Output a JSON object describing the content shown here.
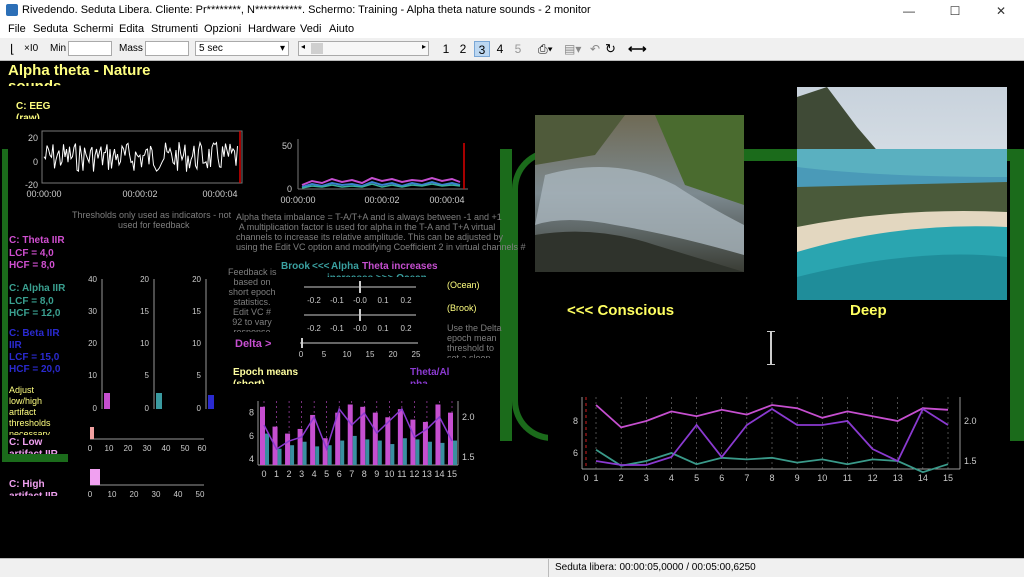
{
  "window": {
    "title": "Rivedendo. Seduta Libera. Cliente: Pr********, N***********. Schermo: Training - Alpha theta nature sounds - 2 monitor",
    "minimize": "—",
    "maximize": "☐",
    "close": "✕"
  },
  "menu": [
    "File",
    "Seduta",
    "Schermi",
    "Edita",
    "Strumenti",
    "Opzioni",
    "Hardware",
    "Vedi",
    "Aiuto"
  ],
  "toolbar": {
    "x0": "×I0",
    "min_label": "Min",
    "max_label": "Mass",
    "time_select": "5 sec",
    "pages": [
      "1",
      "2",
      "3",
      "4",
      "5"
    ],
    "active_page": "3"
  },
  "status": {
    "text": "Seduta libera: 00:00:05,0000 / 00:05:00,6250"
  },
  "screen": {
    "title": "Alpha theta - Nature",
    "title2": "sounds",
    "eeg_label": "C: EEG",
    "eeg_label2": "(raw)",
    "eeg_ticks": [
      "20",
      "0",
      "-20"
    ],
    "time_ticks": [
      "00:00:00",
      "00:00:02",
      "00:00:04"
    ],
    "fft_tick": "50",
    "fft_zero": "0",
    "thresholds_note": "Thresholds only used as indicators - not",
    "thresholds_note2": "used for feedback",
    "imbalance_note": [
      "Alpha theta imbalance = T-A/T+A and is always between -1 and +1",
      "A multiplication factor is used for alpha in the T-A and T+A virtual",
      "channels to increase its relative amplitude.  This can be adjusted by",
      "using the Edit VC option and modifying Coefficient 2 in virtual channels #"
    ],
    "theta_iir": "C: Theta IIR",
    "theta_lcf": "LCF = 4,0",
    "theta_hcf": "HCF = 8,0",
    "alpha_iir": "C: Alpha IIR",
    "alpha_lcf": "LCF = 8,0",
    "alpha_hcf": "HCF = 12,0",
    "beta_iir": "C: Beta IIR",
    "beta_iir2": "IIR",
    "beta_lcf": "LCF = 15,0",
    "beta_hcf": "HCF = 20,0",
    "adjust_note": [
      "Adjust",
      "low/high",
      "artifact",
      "thresholds",
      "necessary"
    ],
    "low_label": "C: Low",
    "low_label2": "artifact IIR",
    "high_label": "C: High",
    "high_label2": "artifact IIR",
    "bar_ticks": [
      "40",
      "30",
      "20",
      "10",
      "0"
    ],
    "bar_ticks2": [
      "20",
      "15",
      "10",
      "5",
      "0"
    ],
    "hbar_ticks": [
      "0",
      "10",
      "20",
      "30",
      "40",
      "50",
      "60"
    ],
    "hbar_ticks2": [
      "0",
      "10",
      "20",
      "30",
      "40",
      "50"
    ],
    "feedback_note": [
      "Feedback is",
      "based on",
      "short epoch",
      "statistics.",
      "Edit VC #",
      "92 to vary",
      "response"
    ],
    "brook": "Brook",
    "arrows_left": "<<<",
    "alpha_word": "Alpha",
    "theta_increases": "Theta increases",
    "increases_line": "increases  >>>  Ocean",
    "scale_ticks": [
      "-0.2",
      "-0.1",
      "-0.0",
      "0.1",
      "0.2"
    ],
    "scale_ticks_b": [
      "0",
      "5",
      "10",
      "15",
      "20",
      "25"
    ],
    "delta": "Delta >",
    "ocean": "(Ocean)",
    "brook_paren": "(Brook)",
    "delta_note": [
      "Use the Delta",
      "epoch mean",
      "threshold to",
      "set a sleep"
    ],
    "epoch_means": "Epoch means",
    "epoch_means2": "(short)",
    "theta_al": "Theta/Al",
    "theta_al2": "pha",
    "conscious": "<<<  Conscious",
    "deep": "Deep"
  },
  "chart_data": [
    {
      "type": "bar",
      "title": "Epoch means (short)",
      "x": [
        0,
        1,
        2,
        3,
        4,
        5,
        6,
        7,
        8,
        9,
        10,
        11,
        12,
        13,
        14,
        15
      ],
      "ylim": [
        3.5,
        9
      ],
      "y2lim": [
        1.4,
        2.2
      ],
      "series": [
        {
          "name": "Theta",
          "color": "#c64fd0",
          "values": [
            8.5,
            6.8,
            6.2,
            6.6,
            7.8,
            5.8,
            8.0,
            8.7,
            8.5,
            8.0,
            7.6,
            8.3,
            7.4,
            7.2,
            8.7,
            8.0
          ]
        },
        {
          "name": "Alpha",
          "color": "#3a8fa0",
          "values": [
            6.2,
            4.9,
            5.2,
            5.5,
            5.1,
            5.2,
            5.6,
            6.0,
            5.7,
            5.6,
            5.3,
            5.8,
            5.7,
            5.5,
            5.4,
            5.6
          ]
        },
        {
          "name": "Theta/Alpha",
          "color": "#8a3ad0",
          "values": [
            1.9,
            1.6,
            1.7,
            1.75,
            2.0,
            1.6,
            2.1,
            1.9,
            2.05,
            1.8,
            1.95,
            2.1,
            1.75,
            1.85,
            2.0,
            1.7
          ]
        }
      ]
    },
    {
      "type": "line",
      "x": [
        1,
        2,
        3,
        4,
        5,
        6,
        7,
        8,
        9,
        10,
        11,
        12,
        13,
        14,
        15
      ],
      "ylim": [
        5,
        9.5
      ],
      "y2lim": [
        1.4,
        2.3
      ],
      "series": [
        {
          "name": "Theta",
          "color": "#c64fd0",
          "values": [
            9.0,
            7.6,
            8.0,
            8.6,
            8.3,
            8.7,
            8.4,
            9.0,
            8.8,
            8.2,
            8.6,
            8.3,
            8.0,
            8.8,
            8.7
          ]
        },
        {
          "name": "Alpha",
          "color": "#3a9a8a",
          "values": [
            6.2,
            5.2,
            5.5,
            6.0,
            5.3,
            5.7,
            5.6,
            5.7,
            5.4,
            5.6,
            5.3,
            5.6,
            5.5,
            4.8,
            5.3
          ]
        },
        {
          "name": "Theta/Alpha",
          "color": "#8a3ad0",
          "values": [
            1.5,
            1.45,
            1.45,
            1.55,
            1.95,
            1.55,
            1.95,
            2.15,
            1.95,
            1.95,
            2.0,
            1.65,
            1.5,
            2.15,
            1.95
          ]
        }
      ]
    }
  ]
}
